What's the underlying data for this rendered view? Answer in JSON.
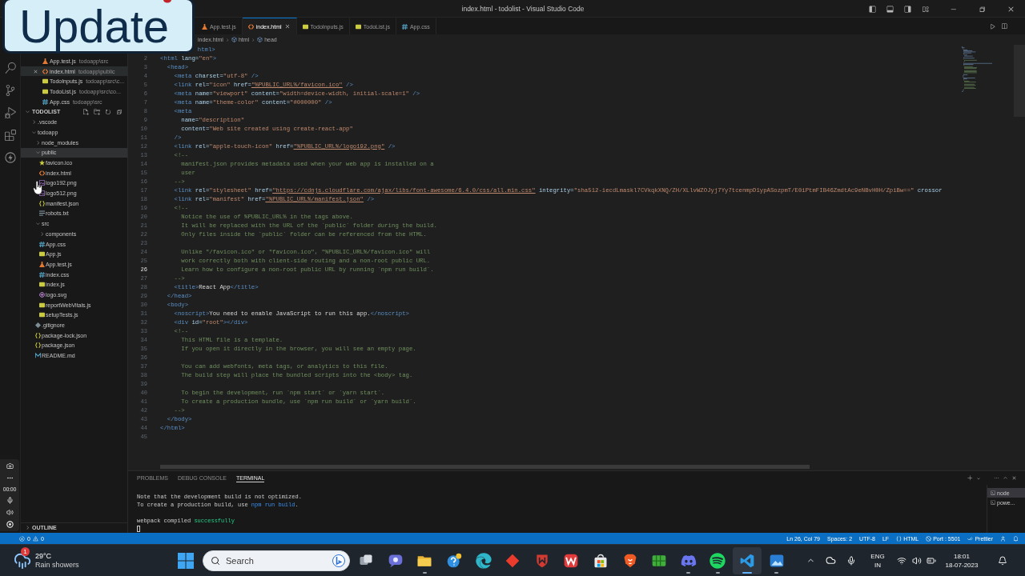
{
  "window": {
    "title": "index.html - todolist - Visual Studio Code"
  },
  "overlay_card": {
    "label": "Update"
  },
  "recorder": {
    "timer": "00:00"
  },
  "open_editors": [
    {
      "name": "App.test.js",
      "path": "todoapp\\src",
      "kind": "test",
      "selected": false
    },
    {
      "name": "index.html",
      "path": "todoapp\\public",
      "kind": "html",
      "selected": true
    },
    {
      "name": "TodoInputs.js",
      "path": "todoapp\\src\\c...",
      "kind": "js",
      "selected": false
    },
    {
      "name": "TodoList.js",
      "path": "todoapp\\src\\co...",
      "kind": "js",
      "selected": false
    },
    {
      "name": "App.css",
      "path": "todoapp\\src",
      "kind": "css",
      "selected": false
    }
  ],
  "explorer": {
    "title": "TODOLIST",
    "tree": [
      {
        "name": ".vscode",
        "kind": "folder",
        "expanded": false,
        "selected": false
      },
      {
        "name": "todoapp",
        "kind": "folder",
        "expanded": true,
        "selected": false,
        "children": [
          {
            "name": "node_modules",
            "kind": "folder",
            "expanded": false,
            "selected": false
          },
          {
            "name": "public",
            "kind": "folder",
            "expanded": true,
            "selected": true,
            "children": [
              {
                "name": "favicon.ico",
                "kind": "ico",
                "selected": false
              },
              {
                "name": "index.html",
                "kind": "html",
                "selected": false
              },
              {
                "name": "logo192.png",
                "kind": "image",
                "selected": false
              },
              {
                "name": "logo512.png",
                "kind": "image",
                "selected": false
              },
              {
                "name": "manifest.json",
                "kind": "json",
                "selected": false
              },
              {
                "name": "robots.txt",
                "kind": "text",
                "selected": false
              }
            ]
          },
          {
            "name": "src",
            "kind": "folder",
            "expanded": true,
            "selected": false,
            "children": [
              {
                "name": "components",
                "kind": "folder",
                "expanded": false,
                "selected": false
              },
              {
                "name": "App.css",
                "kind": "css",
                "selected": false
              },
              {
                "name": "App.js",
                "kind": "js",
                "selected": false
              },
              {
                "name": "App.test.js",
                "kind": "test",
                "selected": false
              },
              {
                "name": "index.css",
                "kind": "css",
                "selected": false
              },
              {
                "name": "index.js",
                "kind": "js",
                "selected": false
              },
              {
                "name": "logo.svg",
                "kind": "svg",
                "selected": false
              },
              {
                "name": "reportWebVitals.js",
                "kind": "js",
                "selected": false
              },
              {
                "name": "setupTests.js",
                "kind": "js",
                "selected": false
              }
            ]
          },
          {
            "name": ".gitignore",
            "kind": "git",
            "selected": false
          },
          {
            "name": "package-lock.json",
            "kind": "json",
            "selected": false
          },
          {
            "name": "package.json",
            "kind": "json",
            "selected": false
          },
          {
            "name": "README.md",
            "kind": "markdown",
            "selected": false
          }
        ]
      }
    ]
  },
  "outline": {
    "title": "OUTLINE",
    "expanded": false
  },
  "tabs": [
    {
      "label": "App.test.js",
      "kind": "test",
      "selected": false
    },
    {
      "label": "index.html",
      "kind": "html",
      "selected": true
    },
    {
      "label": "TodoInputs.js",
      "kind": "js",
      "selected": false
    },
    {
      "label": "TodoList.js",
      "kind": "js",
      "selected": false
    },
    {
      "label": "App.css",
      "kind": "css",
      "selected": false
    }
  ],
  "breadcrumb": [
    "index.html",
    "html",
    "head"
  ],
  "editor": {
    "lines": [
      {
        "tokens": [
          {
            "kind": "tag",
            "text": "html>"
          }
        ]
      },
      {
        "n": "2",
        "current": false,
        "tokens": [
          {
            "kind": "tag",
            "text": "<html"
          },
          {
            "kind": "attr",
            "text": " lang="
          },
          {
            "kind": "string",
            "text": "\"en\""
          },
          {
            "kind": "tag",
            "text": ">"
          }
        ],
        "children": [
          {
            "n": "3",
            "current": false,
            "tokens": [
              {
                "kind": "tag",
                "text": "<head>"
              }
            ],
            "children": [
              {
                "n": "4",
                "current": false,
                "tokens": [
                  {
                    "kind": "tag",
                    "text": "<meta"
                  },
                  {
                    "kind": "attr",
                    "text": " charset="
                  },
                  {
                    "kind": "string",
                    "text": "\"utf-8\""
                  },
                  {
                    "kind": "tag",
                    "text": " />"
                  }
                ]
              },
              {
                "n": "5",
                "current": false,
                "tokens": [
                  {
                    "kind": "tag",
                    "text": "<link"
                  },
                  {
                    "kind": "attr",
                    "text": " rel="
                  },
                  {
                    "kind": "string",
                    "text": "\"icon\""
                  },
                  {
                    "kind": "attr",
                    "text": " href="
                  },
                  {
                    "kind": "link",
                    "text": "\"%PUBLIC_URL%/favicon.ico\""
                  },
                  {
                    "kind": "tag",
                    "text": " />"
                  }
                ]
              },
              {
                "n": "6",
                "current": false,
                "tokens": [
                  {
                    "kind": "tag",
                    "text": "<meta"
                  },
                  {
                    "kind": "attr",
                    "text": " name="
                  },
                  {
                    "kind": "string",
                    "text": "\"viewport\""
                  },
                  {
                    "kind": "attr",
                    "text": " content="
                  },
                  {
                    "kind": "string",
                    "text": "\"width=device-width, initial-scale=1\""
                  },
                  {
                    "kind": "tag",
                    "text": " />"
                  }
                ]
              },
              {
                "n": "7",
                "current": false,
                "tokens": [
                  {
                    "kind": "tag",
                    "text": "<meta"
                  },
                  {
                    "kind": "attr",
                    "text": " name="
                  },
                  {
                    "kind": "string",
                    "text": "\"theme-color\""
                  },
                  {
                    "kind": "attr",
                    "text": " content="
                  },
                  {
                    "kind": "string",
                    "text": "\"#000000\""
                  },
                  {
                    "kind": "tag",
                    "text": " />"
                  }
                ]
              },
              {
                "n": "8",
                "current": false,
                "tokens": [
                  {
                    "kind": "tag",
                    "text": "<meta"
                  }
                ],
                "children": [
                  {
                    "n": "9",
                    "current": false,
                    "tokens": [
                      {
                        "kind": "attr",
                        "text": "name="
                      },
                      {
                        "kind": "string",
                        "text": "\"description\""
                      }
                    ]
                  },
                  {
                    "n": "10",
                    "current": false,
                    "tokens": [
                      {
                        "kind": "attr",
                        "text": "content="
                      },
                      {
                        "kind": "string",
                        "text": "\"Web site created using create-react-app\""
                      }
                    ]
                  }
                ]
              },
              {
                "n": "11",
                "current": false,
                "tokens": [
                  {
                    "kind": "tag",
                    "text": "/>"
                  }
                ]
              },
              {
                "n": "12",
                "current": false,
                "tokens": [
                  {
                    "kind": "tag",
                    "text": "<link"
                  },
                  {
                    "kind": "attr",
                    "text": " rel="
                  },
                  {
                    "kind": "string",
                    "text": "\"apple-touch-icon\""
                  },
                  {
                    "kind": "attr",
                    "text": " href="
                  },
                  {
                    "kind": "link",
                    "text": "\"%PUBLIC_URL%/logo192.png\""
                  },
                  {
                    "kind": "tag",
                    "text": " />"
                  }
                ]
              },
              {
                "n": "13",
                "current": false,
                "tokens": [
                  {
                    "kind": "comment",
                    "text": "<!--"
                  }
                ],
                "children": [
                  {
                    "n": "14",
                    "current": false,
                    "tokens": [
                      {
                        "kind": "comment",
                        "text": "manifest.json provides metadata used when your web app is installed on a"
                      }
                    ]
                  },
                  {
                    "n": "15",
                    "current": false,
                    "tokens": [
                      {
                        "kind": "comment",
                        "text": "user"
                      }
                    ]
                  }
                ]
              },
              {
                "n": "16",
                "current": false,
                "tokens": [
                  {
                    "kind": "comment",
                    "text": "-->"
                  }
                ]
              },
              {
                "n": "17",
                "current": false,
                "tokens": [
                  {
                    "kind": "tag",
                    "text": "<link"
                  },
                  {
                    "kind": "attr",
                    "text": " rel="
                  },
                  {
                    "kind": "string",
                    "text": "\"stylesheet\""
                  },
                  {
                    "kind": "attr",
                    "text": " href="
                  },
                  {
                    "kind": "link",
                    "text": "\"https://cdnjs.cloudflare.com/ajax/libs/font-awesome/6.4.0/css/all.min.css\""
                  },
                  {
                    "kind": "attr",
                    "text": " integrity="
                  },
                  {
                    "kind": "string",
                    "text": "\"sha512-iecdLmaskl7CVkqkXNQ/ZH/XLlvWZOJyj7Yy7tcenmpD1ypASozpmT/E0iPtmFIB46ZmdtAc9eNBvH0H/ZpiBw==\""
                  },
                  {
                    "kind": "attr",
                    "text": " crossor"
                  }
                ]
              },
              {
                "n": "18",
                "current": false,
                "tokens": [
                  {
                    "kind": "tag",
                    "text": "<link"
                  },
                  {
                    "kind": "attr",
                    "text": " rel="
                  },
                  {
                    "kind": "string",
                    "text": "\"manifest\""
                  },
                  {
                    "kind": "attr",
                    "text": " href="
                  },
                  {
                    "kind": "link",
                    "text": "\"%PUBLIC_URL%/manifest.json\""
                  },
                  {
                    "kind": "tag",
                    "text": " />"
                  }
                ]
              },
              {
                "n": "19",
                "current": false,
                "tokens": [
                  {
                    "kind": "comment",
                    "text": "<!--"
                  }
                ],
                "children": [
                  {
                    "n": "20",
                    "current": false,
                    "tokens": [
                      {
                        "kind": "comment",
                        "text": "Notice the use of %PUBLIC_URL% in the tags above."
                      }
                    ]
                  },
                  {
                    "n": "21",
                    "current": false,
                    "tokens": [
                      {
                        "kind": "comment",
                        "text": "It will be replaced with the URL of the `public` folder during the build."
                      }
                    ]
                  },
                  {
                    "n": "22",
                    "current": false,
                    "tokens": [
                      {
                        "kind": "comment",
                        "text": "Only files inside the `public` folder can be referenced from the HTML."
                      }
                    ]
                  },
                  {
                    "n": "23",
                    "current": false
                  },
                  {
                    "n": "24",
                    "current": false,
                    "tokens": [
                      {
                        "kind": "comment",
                        "text": "Unlike \"/favicon.ico\" or \"favicon.ico\", \"%PUBLIC_URL%/favicon.ico\" will"
                      }
                    ]
                  },
                  {
                    "n": "25",
                    "current": false,
                    "tokens": [
                      {
                        "kind": "comment",
                        "text": "work correctly both with client-side routing and a non-root public URL."
                      }
                    ]
                  },
                  {
                    "n": "26",
                    "current": true,
                    "tokens": [
                      {
                        "kind": "comment",
                        "text": "Learn how to configure a non-root public URL by running `npm run build`."
                      }
                    ]
                  }
                ]
              },
              {
                "n": "27",
                "current": false,
                "tokens": [
                  {
                    "kind": "comment",
                    "text": "-->"
                  }
                ]
              },
              {
                "n": "28",
                "current": false,
                "tokens": [
                  {
                    "kind": "tag",
                    "text": "<title>"
                  },
                  {
                    "kind": "text",
                    "text": "React App"
                  },
                  {
                    "kind": "tag",
                    "text": "</title>"
                  }
                ]
              }
            ]
          },
          {
            "n": "29",
            "current": false,
            "tokens": [
              {
                "kind": "tag",
                "text": "</head>"
              }
            ]
          },
          {
            "n": "30",
            "current": false,
            "tokens": [
              {
                "kind": "tag",
                "text": "<body>"
              }
            ],
            "children": [
              {
                "n": "31",
                "current": false,
                "tokens": [
                  {
                    "kind": "tag",
                    "text": "<noscript>"
                  },
                  {
                    "kind": "text",
                    "text": "You need to enable JavaScript to run this app."
                  },
                  {
                    "kind": "tag",
                    "text": "</noscript>"
                  }
                ]
              },
              {
                "n": "32",
                "current": false,
                "tokens": [
                  {
                    "kind": "tag",
                    "text": "<div"
                  },
                  {
                    "kind": "attr",
                    "text": " id="
                  },
                  {
                    "kind": "string",
                    "text": "\"root\""
                  },
                  {
                    "kind": "tag",
                    "text": "></div>"
                  }
                ]
              },
              {
                "n": "33",
                "current": false,
                "tokens": [
                  {
                    "kind": "comment",
                    "text": "<!--"
                  }
                ],
                "children": [
                  {
                    "n": "34",
                    "current": false,
                    "tokens": [
                      {
                        "kind": "comment",
                        "text": "This HTML file is a template."
                      }
                    ]
                  },
                  {
                    "n": "35",
                    "current": false,
                    "tokens": [
                      {
                        "kind": "comment",
                        "text": "If you open it directly in the browser, you will see an empty page."
                      }
                    ]
                  },
                  {
                    "n": "36",
                    "current": false
                  },
                  {
                    "n": "37",
                    "current": false,
                    "tokens": [
                      {
                        "kind": "comment",
                        "text": "You can add webfonts, meta tags, or analytics to this file."
                      }
                    ]
                  },
                  {
                    "n": "38",
                    "current": false,
                    "tokens": [
                      {
                        "kind": "comment",
                        "text": "The build step will place the bundled scripts into the <body> tag."
                      }
                    ]
                  },
                  {
                    "n": "39",
                    "current": false
                  },
                  {
                    "n": "40",
                    "current": false,
                    "tokens": [
                      {
                        "kind": "comment",
                        "text": "To begin the development, run `npm start` or `yarn start`."
                      }
                    ]
                  },
                  {
                    "n": "41",
                    "current": false,
                    "tokens": [
                      {
                        "kind": "comment",
                        "text": "To create a production bundle, use `npm run build` or `yarn build`."
                      }
                    ]
                  }
                ]
              },
              {
                "n": "42",
                "current": false,
                "tokens": [
                  {
                    "kind": "comment",
                    "text": "-->"
                  }
                ]
              }
            ]
          },
          {
            "n": "43",
            "current": false,
            "tokens": [
              {
                "kind": "tag",
                "text": "</body>"
              }
            ]
          }
        ]
      },
      {
        "n": "44",
        "current": false,
        "tokens": [
          {
            "kind": "tag",
            "text": "</html>"
          }
        ]
      },
      {
        "n": "45",
        "current": false
      }
    ]
  },
  "panel": {
    "tabs": [
      {
        "label": "PROBLEMS",
        "selected": false
      },
      {
        "label": "DEBUG CONSOLE",
        "selected": false
      },
      {
        "label": "TERMINAL",
        "selected": true
      }
    ],
    "terminal": {
      "paragraphs": [
        {
          "lines": [
            [
              {
                "kind": "plain",
                "text": "Note that the development build is not optimized."
              }
            ],
            [
              {
                "kind": "plain",
                "text": "To create a production build, use "
              },
              {
                "kind": "command",
                "text": "npm run build"
              },
              {
                "kind": "plain",
                "text": "."
              }
            ]
          ]
        },
        {
          "lines": [
            [
              {
                "kind": "plain",
                "text": "webpack compiled "
              },
              {
                "kind": "success",
                "text": "successfully"
              }
            ]
          ]
        }
      ],
      "cursor": true
    },
    "sessions": [
      {
        "label": "node",
        "selected": true
      },
      {
        "label": "powe...",
        "selected": false
      }
    ]
  },
  "status_bar": {
    "errors": "0",
    "warnings": "0",
    "items": [
      {
        "kind": "plain",
        "text": "Ln 26, Col 79"
      },
      {
        "kind": "plain",
        "text": "Spaces: 2"
      },
      {
        "kind": "plain",
        "text": "UTF-8"
      },
      {
        "kind": "plain",
        "text": "LF"
      },
      {
        "kind": "language",
        "text": "HTML"
      },
      {
        "kind": "port",
        "text": "Port : 5501"
      },
      {
        "kind": "formatter",
        "text": "Prettier"
      }
    ]
  },
  "taskbar": {
    "weather": {
      "badge": "1",
      "temperature": "29°C",
      "condition": "Rain showers"
    },
    "search": {
      "placeholder": "Search"
    },
    "apps": [
      {
        "kind": "taskview",
        "running": false,
        "active": false
      },
      {
        "kind": "chat",
        "running": false,
        "active": false
      },
      {
        "kind": "files",
        "running": true,
        "active": false
      },
      {
        "kind": "help",
        "running": false,
        "active": false
      },
      {
        "kind": "edge",
        "running": false,
        "active": false
      },
      {
        "kind": "diamond",
        "running": false,
        "active": false
      },
      {
        "kind": "shield",
        "running": false,
        "active": false
      },
      {
        "kind": "wps",
        "running": false,
        "active": false
      },
      {
        "kind": "store",
        "running": false,
        "active": false
      },
      {
        "kind": "brave",
        "running": false,
        "active": false
      },
      {
        "kind": "tiles",
        "running": false,
        "active": false
      },
      {
        "kind": "discord",
        "running": true,
        "active": false
      },
      {
        "kind": "spotify",
        "running": true,
        "active": false
      },
      {
        "kind": "vscode",
        "running": true,
        "active": true
      },
      {
        "kind": "photos",
        "running": true,
        "active": false
      }
    ],
    "tray": {
      "language": "ENG",
      "region": "IN",
      "time": "18:01",
      "date": "18-07-2023"
    }
  }
}
